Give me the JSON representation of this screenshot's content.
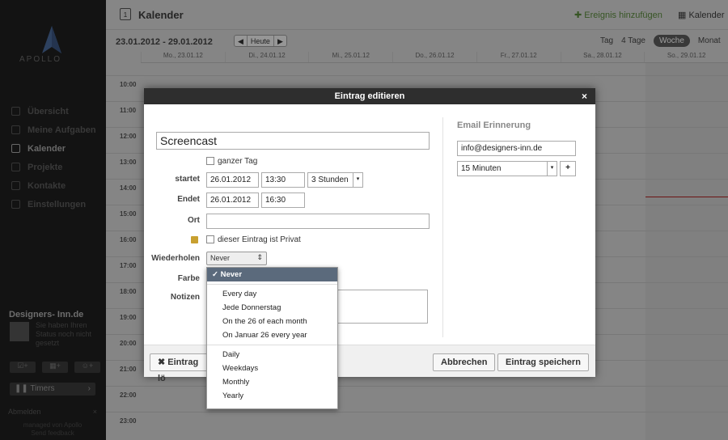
{
  "sidebar": {
    "top_text": "",
    "logo_text": "APOLLO",
    "nav": [
      {
        "label": "Übersicht",
        "icon": "overview-icon"
      },
      {
        "label": "Meine Aufgaben",
        "icon": "tasks-icon"
      },
      {
        "label": "Kalender",
        "icon": "calendar-icon",
        "active": true
      },
      {
        "label": "Projekte",
        "icon": "projects-icon"
      },
      {
        "label": "Kontakte",
        "icon": "contacts-icon"
      },
      {
        "label": "Einstellungen",
        "icon": "settings-icon"
      }
    ],
    "user_name": "Designers- Inn.de",
    "status_text": "Sie haben Ihren Status noch nicht gesetzt",
    "timers_label": "Timers",
    "abmelden_label": "Abmelden",
    "footer_line1": "managed von Apollo",
    "footer_line2": "Send feedback"
  },
  "header": {
    "title": "Kalender",
    "add_event": "Ereignis hinzufügen",
    "calendar_link": "Kalender",
    "date_range": "23.01.2012 - 29.01.2012",
    "today_btn": "Heute",
    "prev": "◀",
    "next": "▶",
    "views": [
      {
        "label": "Tag"
      },
      {
        "label": "4 Tage"
      },
      {
        "label": "Woche",
        "active": true
      },
      {
        "label": "Monat"
      }
    ]
  },
  "days": [
    "Mo., 23.01.12",
    "Di., 24.01.12",
    "Mi., 25.01.12",
    "Do., 26.01.12",
    "Fr., 27.01.12",
    "Sa., 28.01.12",
    "So., 29.01.12"
  ],
  "hours": [
    "10:00",
    "11:00",
    "12:00",
    "13:00",
    "14:00",
    "15:00",
    "16:00",
    "17:00",
    "18:00",
    "19:00",
    "20:00",
    "21:00",
    "22:00",
    "23:00"
  ],
  "modal": {
    "title": "Eintrag editieren",
    "close": "×",
    "event_title": "Screencast",
    "all_day_label": "ganzer Tag",
    "start_label": "startet",
    "start_date": "26.01.2012",
    "start_time": "13:30",
    "duration": "3 Stunden",
    "end_label": "Endet",
    "end_date": "26.01.2012",
    "end_time": "16:30",
    "location_label": "Ort",
    "private_label": "dieser Eintrag ist Privat",
    "repeat_label": "Wiederholen",
    "repeat_value": "Never",
    "color_label": "Farbe",
    "notes_label": "Notizen",
    "email_title": "Email Erinnerung",
    "email_value": "info@designers-inn.de",
    "reminder": "15 Minuten",
    "add_reminder": "+",
    "delete_btn": "Eintrag lö",
    "cancel_btn": "Abbrechen",
    "save_btn": "Eintrag speichern"
  },
  "repeat_options": {
    "selected": "Never",
    "group1": [
      "Every day",
      "Jede Donnerstag",
      "On the 26 of each month",
      "On Januar 26 every year"
    ],
    "group2": [
      "Daily",
      "Weekdays",
      "Monthly",
      "Yearly"
    ]
  },
  "colors": {
    "accent_green": "#5a8a3c",
    "today_line": "#b02020",
    "selected_option": "#5b6a7c"
  }
}
